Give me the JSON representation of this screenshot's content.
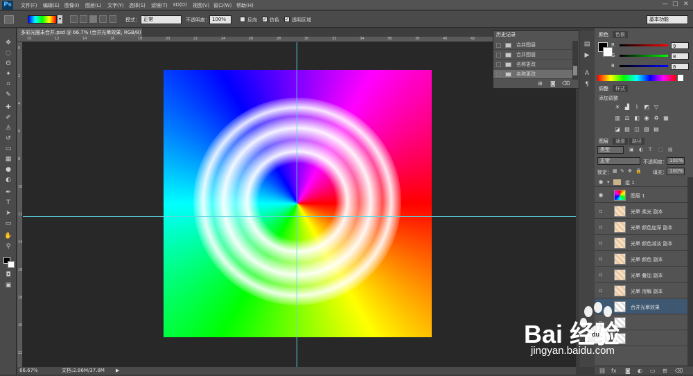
{
  "app": {
    "logo": "Ps"
  },
  "menu": [
    "文件(F)",
    "编辑(E)",
    "图像(I)",
    "图层(L)",
    "文字(Y)",
    "选择(S)",
    "滤镜(T)",
    "3D(D)",
    "视图(V)",
    "窗口(W)",
    "帮助(H)"
  ],
  "window_controls": {
    "minimize": "—",
    "maximize": "□",
    "close": "✕"
  },
  "options": {
    "mode_label": "模式：",
    "mode_value": "正常",
    "opacity_label": "不透明度：",
    "opacity_value": "100%",
    "reverse_label": "反向",
    "dither_label": "仿色",
    "transparency_label": "透明区域",
    "workspace": "基本功能"
  },
  "document": {
    "tab_title": "多彩光圈未合并.psd @ 66.7% (合并光晕效果, RGB/8) *",
    "tab_close": "×"
  },
  "ruler": {
    "h": [
      "10",
      "12",
      "14",
      "16",
      "18",
      "20",
      "22",
      "24",
      "26",
      "28",
      "30",
      "32",
      "34",
      "36",
      "38",
      "40",
      "42",
      "44",
      "46",
      "48"
    ],
    "v": [
      "0",
      "2",
      "4",
      "6",
      "8",
      "10",
      "12",
      "14",
      "16",
      "18",
      "20",
      "22"
    ]
  },
  "status": {
    "zoom": "66.67%",
    "doc_info": "文档:2.86M/37.8M"
  },
  "history": {
    "tab": "历史记录",
    "items": [
      "合并图层",
      "合并图层",
      "名称更改",
      "名称更改"
    ]
  },
  "color": {
    "tabs": [
      "颜色",
      "色板"
    ],
    "channels": [
      {
        "label": "R",
        "value": "9"
      },
      {
        "label": "G",
        "value": "8"
      },
      {
        "label": "B",
        "value": "8"
      }
    ]
  },
  "adjust": {
    "tabs": [
      "调整",
      "样式"
    ],
    "add_label": "添加调整"
  },
  "layers": {
    "tabs": [
      "图层",
      "通道",
      "路径"
    ],
    "filter_kind": "类型",
    "blend_mode": "正常",
    "opacity_label": "不透明度：",
    "opacity_value": "100%",
    "lock_label": "锁定：",
    "fill_label": "填充：",
    "fill_value": "100%",
    "group_name": "组 1",
    "items": [
      {
        "name": "图层 1"
      },
      {
        "name": "光晕 柔光 副本"
      },
      {
        "name": "光晕 颜色加深 副本"
      },
      {
        "name": "光晕 颜色减淡 副本"
      },
      {
        "name": "光晕 颜色 副本"
      },
      {
        "name": "光晕 叠加 副本"
      },
      {
        "name": "光晕 溶解 副本"
      },
      {
        "name": "合并光晕效果"
      }
    ]
  },
  "watermark": {
    "brand": "Bai 经验",
    "paw": "du",
    "url": "jingyan.baidu.com"
  },
  "colors": {
    "guide": "#5cd6e6",
    "selected_layer": "#3f5872",
    "watermark": "#ffffff"
  }
}
